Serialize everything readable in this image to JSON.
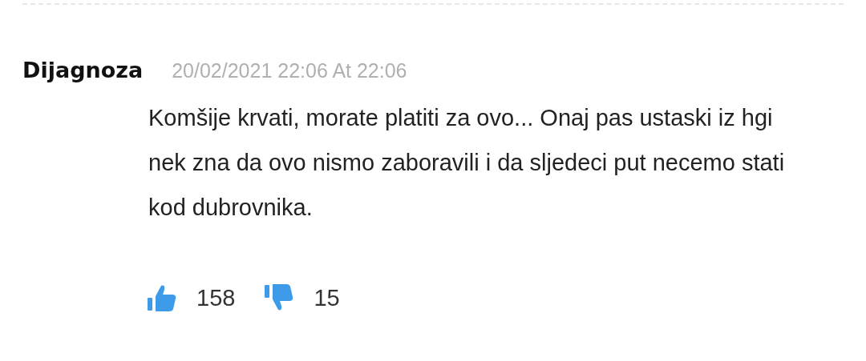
{
  "comment": {
    "author": "Dijagnoza",
    "date": "20/02/2021 22:06 At 22:06",
    "text": "Komšije krvati, morate platiti za ovo... Onaj pas ustaski iz hgi nek zna da ovo nismo zaboravili i da sljedeci put necemo stati kod dubrovnika.",
    "likes": "158",
    "dislikes": "15"
  }
}
